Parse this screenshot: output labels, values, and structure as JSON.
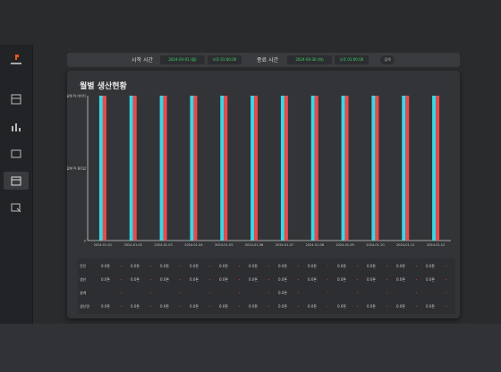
{
  "topbar": {
    "start_label": "시작 시간",
    "start_date": "2024-04-01 (월)",
    "start_time": "오후 01:00:00",
    "end_label": "종료 시간",
    "end_date": "2024-04-30 (화)",
    "end_time": "오후 01:00:00",
    "search_label": "검색"
  },
  "panel": {
    "title": "월별 생산현황"
  },
  "chart_data": {
    "type": "bar",
    "categories": [
      "2024-01-01",
      "2024-01-02",
      "2024-01-03",
      "2024-01-04",
      "2024-01-05",
      "2024-01-06",
      "2024-01-07",
      "2024-01-08",
      "2024-01-09",
      "2024-01-10",
      "2024-01-11",
      "2024-01-12"
    ],
    "y_tick_labels": [
      "값에 따 데이터",
      "값에 따 중간값",
      "0"
    ],
    "ylim": [
      0,
      100
    ],
    "series": [
      {
        "color": "#3ad6e6",
        "values": [
          100,
          100,
          100,
          100,
          100,
          100,
          100,
          100,
          100,
          100,
          100,
          100
        ]
      },
      {
        "color": "#e84a4a",
        "values": [
          100,
          100,
          100,
          100,
          100,
          100,
          100,
          100,
          100,
          100,
          100,
          100
        ]
      }
    ]
  },
  "table": {
    "rows": [
      {
        "label": "전진",
        "cells": [
          "0.0톤",
          "0.0톤",
          "0.0톤",
          "0.0톤",
          "0.0톤",
          "0.0톤",
          "0.0톤",
          "0.0톤",
          "0.0톤",
          "0.0톤",
          "0.0톤",
          "0.0톤"
        ]
      },
      {
        "label": "생산",
        "cells": [
          "0.0톤",
          "0.0톤",
          "0.0톤",
          "0.0톤",
          "0.0톤",
          "0.0톤",
          "0.0톤",
          "0.0톤",
          "0.0톤",
          "0.0톤",
          "0.0톤",
          "0.0톤"
        ]
      },
      {
        "label": "설계",
        "cells": [
          "",
          "",
          "",
          "",
          "",
          "",
          "0.0톤",
          "",
          "",
          "",
          "",
          ""
        ]
      },
      {
        "label": "생산량",
        "cells": [
          "0.0톤",
          "0.0톤",
          "0.0톤",
          "0.0톤",
          "0.0톤",
          "0.0톤",
          "0.0톤",
          "0.0톤",
          "0.0톤",
          "0.0톤",
          "0.0톤",
          "0.0톤"
        ]
      }
    ]
  },
  "colors": {
    "accent_cyan": "#3ad6e6",
    "accent_red": "#e84a4a",
    "time_text": "#3fd46a"
  }
}
